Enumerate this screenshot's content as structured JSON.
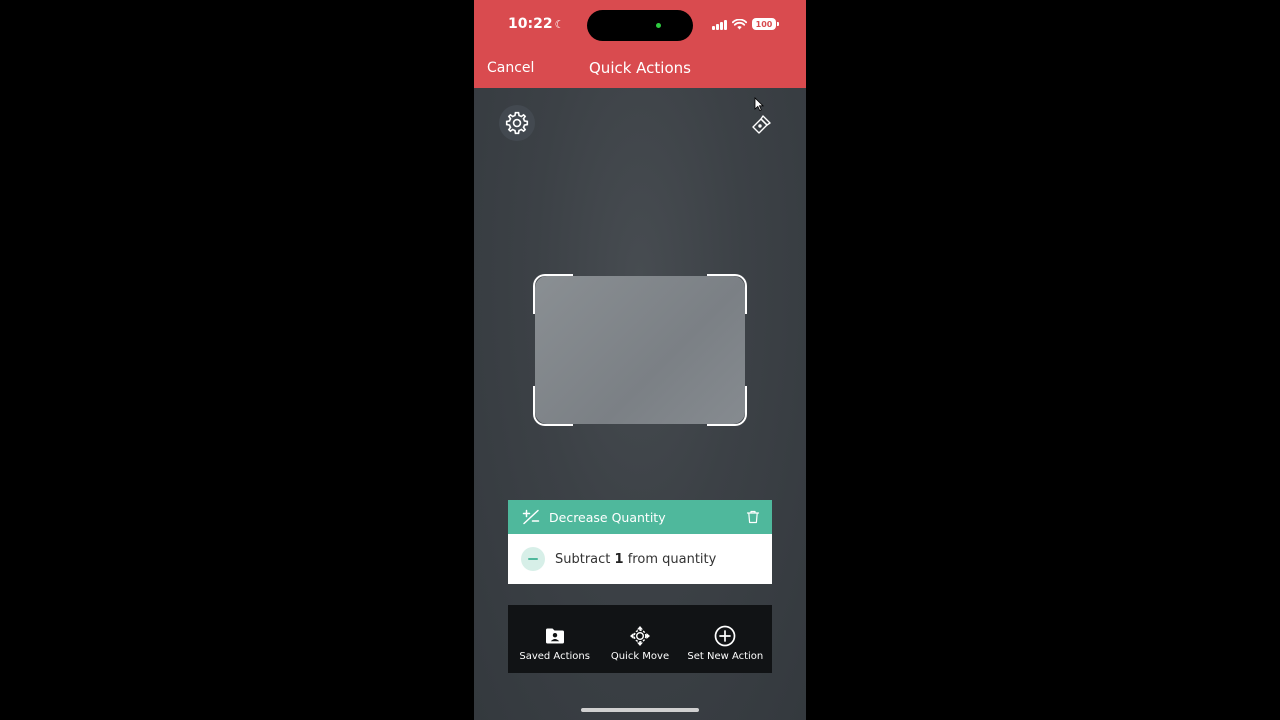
{
  "status_bar": {
    "time": "10:22",
    "battery": "100"
  },
  "header": {
    "cancel_label": "Cancel",
    "title": "Quick Actions"
  },
  "action_card": {
    "title": "Decrease Quantity",
    "body_prefix": "Subtract",
    "body_amount": "1",
    "body_suffix": "from quantity"
  },
  "bottom_bar": {
    "items": [
      {
        "label": "Saved Actions",
        "icon": "folder-person-icon"
      },
      {
        "label": "Quick Move",
        "icon": "move-arrows-icon"
      },
      {
        "label": "Set New Action",
        "icon": "plus-circle-icon"
      }
    ]
  },
  "colors": {
    "header_bg": "#d94b4f",
    "accent_green": "#4fb89c",
    "bottom_bar_bg": "#111315"
  }
}
